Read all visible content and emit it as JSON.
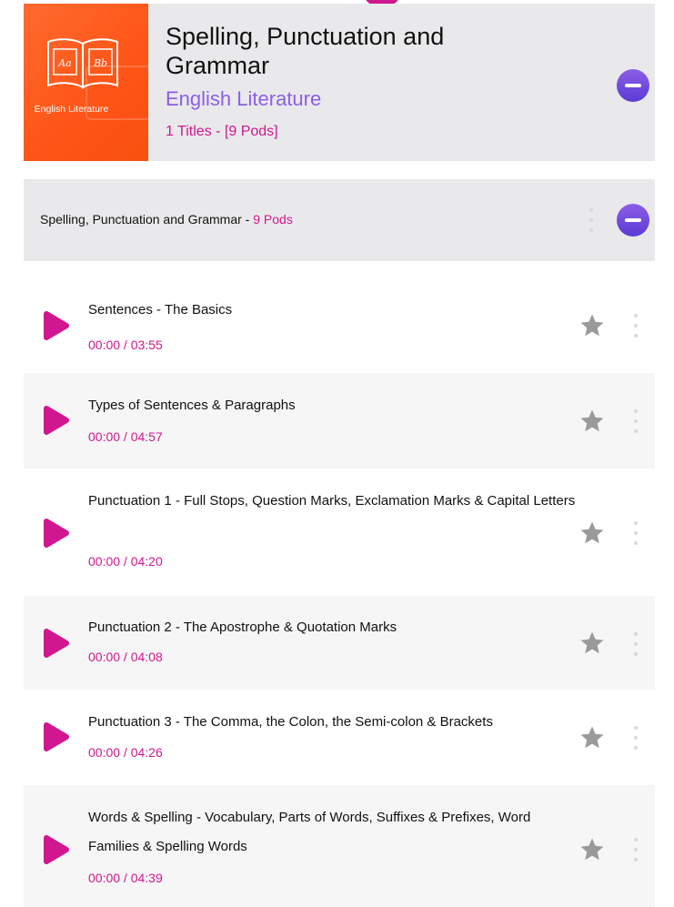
{
  "course": {
    "title": "Spelling, Punctuation and Grammar",
    "subject": "English Literature",
    "count": "1 Titles - [9 Pods]",
    "cover_label": "English Literature",
    "cover_letters": [
      "Aa",
      "Bb"
    ]
  },
  "section": {
    "title": "Spelling, Punctuation and Grammar",
    "separator": " - ",
    "pods": "9 Pods"
  },
  "pods": [
    {
      "title": "Sentences - The Basics",
      "time": "00:00 / 03:55"
    },
    {
      "title": "Types of Sentences & Paragraphs",
      "time": "00:00 / 04:57"
    },
    {
      "title": "Punctuation 1 - Full Stops, Question Marks, Exclamation Marks & Capital Letters",
      "time": "00:00 / 04:20"
    },
    {
      "title": "Punctuation 2 - The Apostrophe & Quotation Marks",
      "time": "00:00 / 04:08"
    },
    {
      "title": "Punctuation 3 - The Comma, the Colon, the Semi-colon & Brackets",
      "time": "00:00 / 04:26"
    },
    {
      "title": "Words & Spelling - Vocabulary, Parts of Words, Suffixes & Prefixes, Word Families & Spelling Words",
      "time": "00:00 / 04:39"
    }
  ],
  "icons": {
    "play": "play-icon",
    "star": "star-icon",
    "more": "more-vertical-icon",
    "collapse": "minus-circle-icon",
    "book": "book-icon"
  },
  "colors": {
    "accent_pink": "#d1178f",
    "accent_purple": "#8c5fe6",
    "cover_orange": "#ff5417",
    "panel_gray": "#e9e9eb",
    "star_gray": "#9a9a9a"
  }
}
